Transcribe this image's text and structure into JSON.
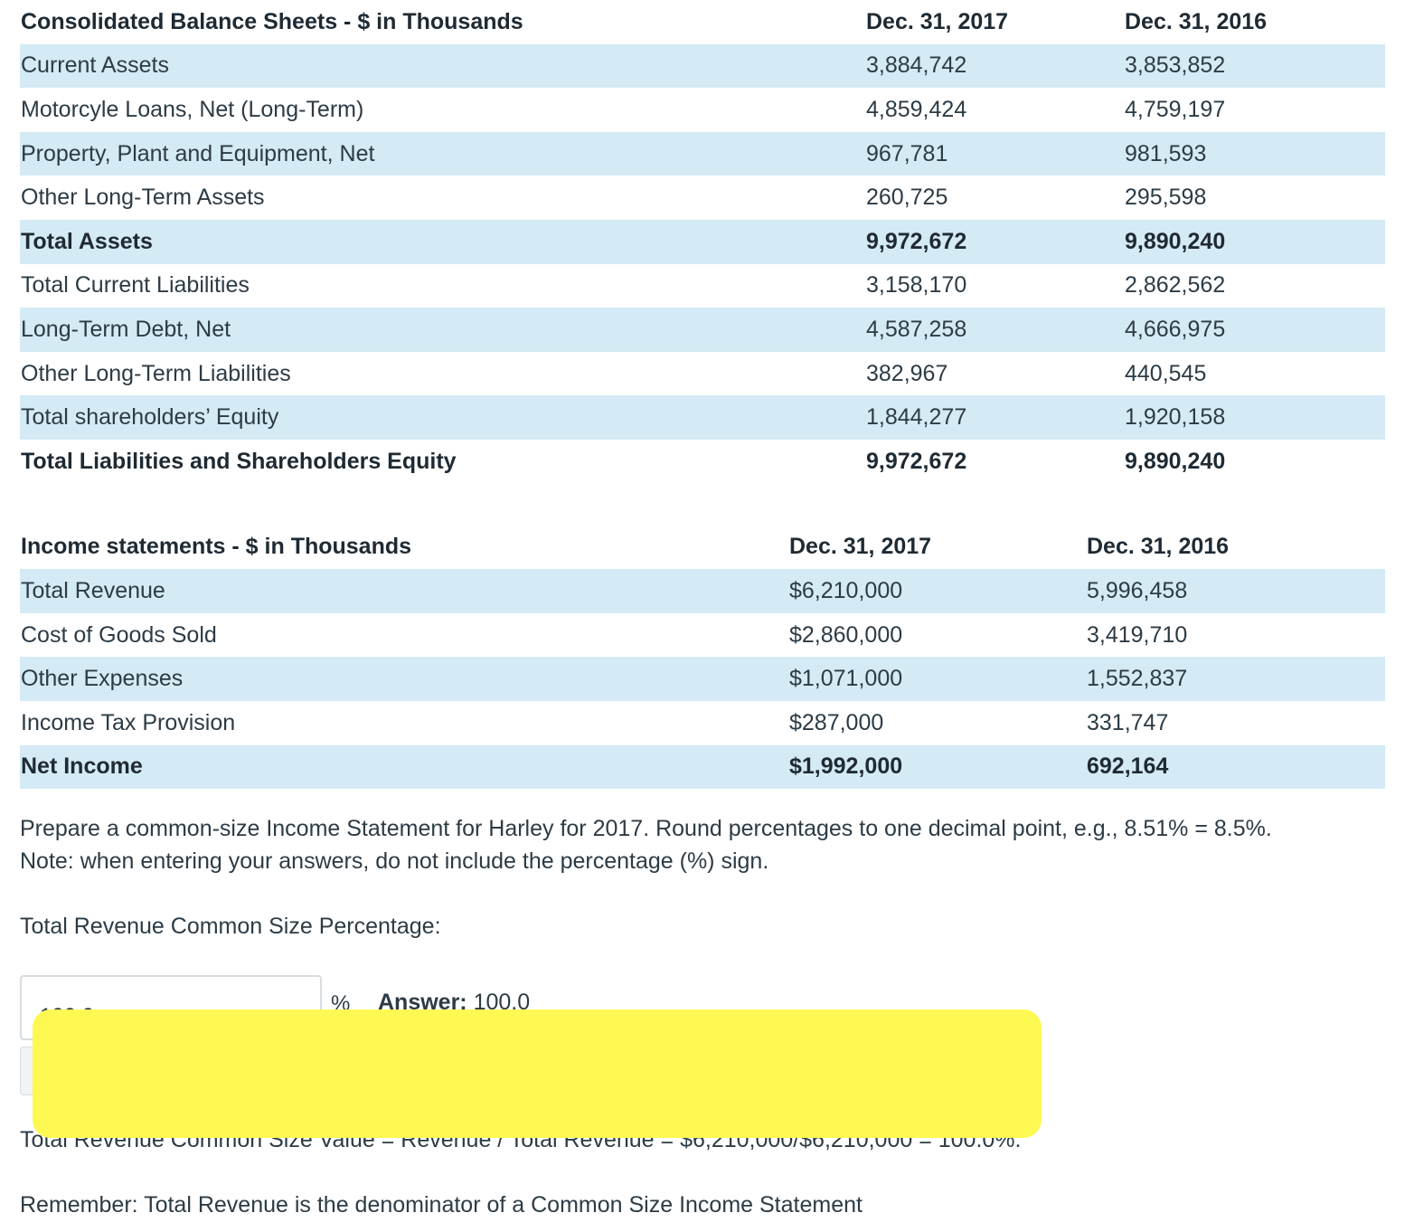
{
  "balance_sheet": {
    "headers": [
      "Consolidated Balance Sheets - $ in Thousands",
      "Dec. 31, 2017",
      "Dec. 31, 2016"
    ],
    "rows": [
      {
        "label": "Current Assets",
        "y2017": "3,884,742",
        "y2016": "3,853,852"
      },
      {
        "label": "Motorcyle Loans, Net (Long-Term)",
        "y2017": "4,859,424",
        "y2016": "4,759,197"
      },
      {
        "label": "Property, Plant and Equipment, Net",
        "y2017": "967,781",
        "y2016": "981,593"
      },
      {
        "label": "Other Long-Term Assets",
        "y2017": "260,725",
        "y2016": "295,598"
      },
      {
        "label": "Total Assets",
        "y2017": "9,972,672",
        "y2016": "9,890,240"
      },
      {
        "label": "Total Current Liabilities",
        "y2017": "3,158,170",
        "y2016": "2,862,562"
      },
      {
        "label": "Long-Term Debt, Net",
        "y2017": "4,587,258",
        "y2016": "4,666,975"
      },
      {
        "label": "Other Long-Term Liabilities",
        "y2017": "382,967",
        "y2016": "440,545"
      },
      {
        "label": "Total shareholders’ Equity",
        "y2017": "1,844,277",
        "y2016": "1,920,158"
      },
      {
        "label": "Total Liabilities and Shareholders Equity",
        "y2017": "9,972,672",
        "y2016": "9,890,240"
      }
    ]
  },
  "income_statement": {
    "headers": [
      "Income statements - $ in Thousands",
      "Dec. 31, 2017",
      "Dec. 31, 2016"
    ],
    "rows": [
      {
        "label": "Total Revenue",
        "y2017": "$6,210,000",
        "y2016": "5,996,458"
      },
      {
        "label": "Cost of Goods Sold",
        "y2017": "$2,860,000",
        "y2016": "3,419,710"
      },
      {
        "label": "Other Expenses",
        "y2017": "$1,071,000",
        "y2016": "1,552,837"
      },
      {
        "label": "Income Tax Provision",
        "y2017": "$287,000",
        "y2016": "331,747"
      },
      {
        "label": "Net Income",
        "y2017": "$1,992,000",
        "y2016": "692,164"
      }
    ]
  },
  "instructions": {
    "line1": "Prepare a common-size Income Statement for Harley for 2017. Round percentages to one decimal point, e.g., 8.51% = 8.5%.",
    "line2": "Note: when entering your answers, do not include the percentage (%) sign."
  },
  "question": {
    "label": "Total Revenue Common Size Percentage:",
    "input_value": "100.0",
    "unit": "%",
    "answer_label": "Answer:",
    "answer_value": "100.0"
  },
  "explanation": "Total Revenue Common Size Value = Revenue / Total Revenue = $6,210,000/$6,210,000 = 100.0%.",
  "reminder": "Remember: Total Revenue is the denominator of a Common Size Income Statement",
  "colors": {
    "row_highlight": "#d4eaf5",
    "redaction": "#fef952"
  }
}
